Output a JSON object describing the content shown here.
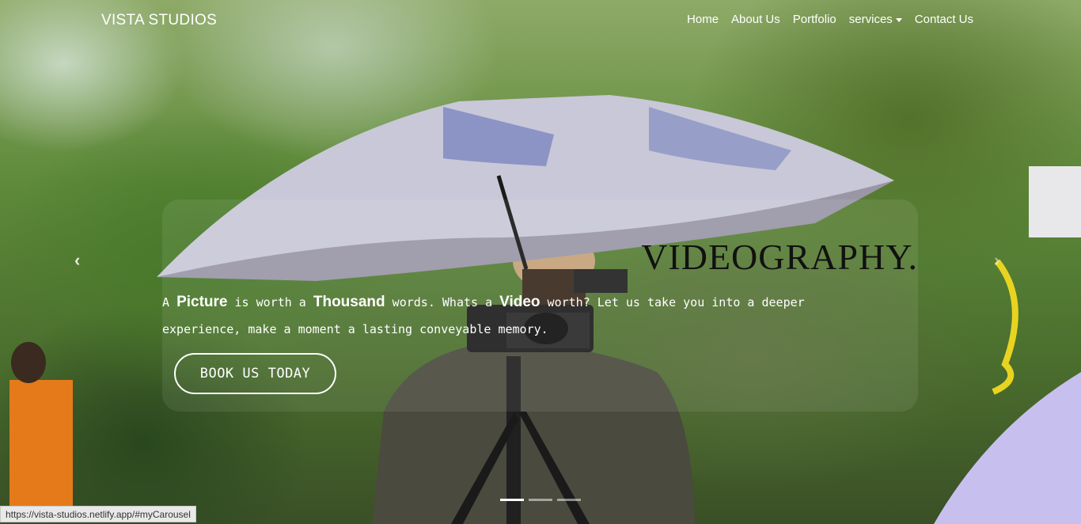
{
  "navbar": {
    "brand": "VISTA STUDIOS",
    "links": [
      "Home",
      "About Us",
      "Portfolio",
      "services",
      "Contact Us"
    ]
  },
  "carousel": {
    "headline": "VIDEOGRAPHY.",
    "tagline": {
      "t1": "A ",
      "b1": "Picture",
      "t2": " is worth a ",
      "b2": "Thousand",
      "t3": " words. Whats a ",
      "b3": "Video",
      "t4": " worth? Let us take you into a deeper experience, make a moment a lasting conveyable memory."
    },
    "cta": "BOOK US TODAY",
    "prev_icon": "‹",
    "next_icon": "›",
    "slide_count": 3,
    "active_slide": 1
  },
  "status_url": "https://vista-studios.netlify.app/#myCarousel",
  "colors": {
    "text": "#ffffff",
    "headline": "#111111"
  }
}
